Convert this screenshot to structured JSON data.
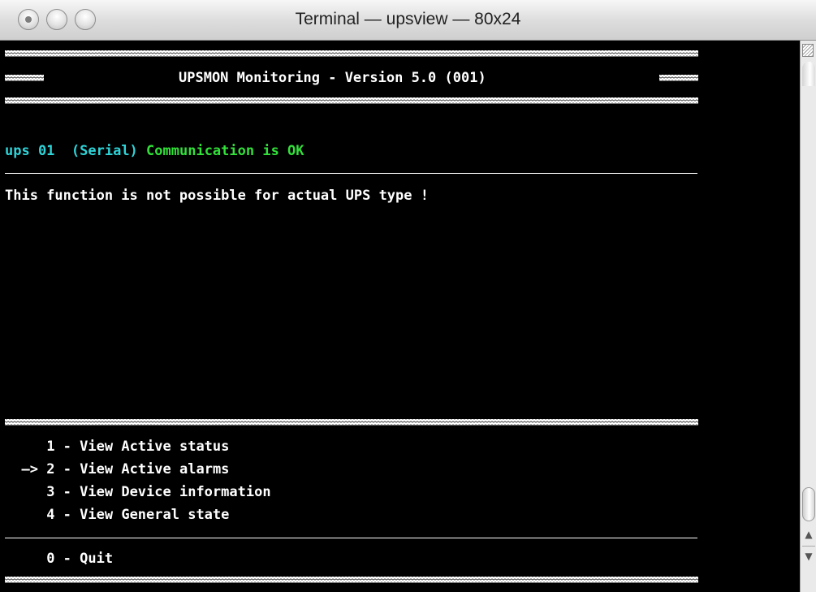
{
  "window": {
    "title": "Terminal — upsview — 80x24"
  },
  "terminal": {
    "header_left": "****",
    "header_title": "UPSMON Monitoring - Version 5.0 (001)",
    "header_right": "****",
    "status": {
      "ups_id": "ups 01",
      "connection": "(Serial)",
      "message": "Communication is OK"
    },
    "notice": "This function is not possible for actual UPS type !",
    "menu": {
      "selected_pointer": "—>",
      "items": [
        {
          "number": "1",
          "label": "View Active status"
        },
        {
          "number": "2",
          "label": "View Active alarms"
        },
        {
          "number": "3",
          "label": "View Device information"
        },
        {
          "number": "4",
          "label": "View General state"
        }
      ],
      "quit": {
        "number": "0",
        "label": "Quit"
      }
    }
  },
  "colors": {
    "background": "#000000",
    "text": "#ffffff",
    "ups_id": "#2fd3d8",
    "status_ok": "#32e03a"
  }
}
